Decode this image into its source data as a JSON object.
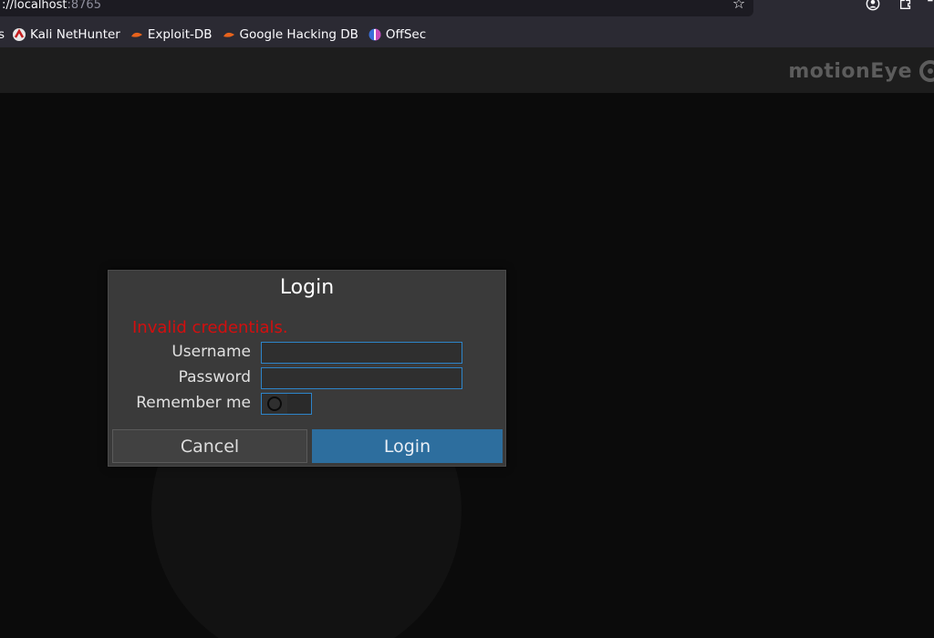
{
  "browser": {
    "url_prefix": "://localhost",
    "url_port": ":8765",
    "bookmarks": {
      "cut_label": "s",
      "items": [
        {
          "label": "Kali NetHunter",
          "icon": "kali-nethunter-icon"
        },
        {
          "label": "Exploit-DB",
          "icon": "exploit-db-icon"
        },
        {
          "label": "Google Hacking DB",
          "icon": "google-hacking-db-icon"
        },
        {
          "label": "OffSec",
          "icon": "offsec-icon"
        }
      ]
    }
  },
  "app": {
    "brand": "motionEye"
  },
  "login_dialog": {
    "title": "Login",
    "error": "Invalid credentials.",
    "username_label": "Username",
    "password_label": "Password",
    "remember_label": "Remember me",
    "username_value": "",
    "password_value": "",
    "remember_checked": false,
    "cancel_label": "Cancel",
    "login_label": "Login"
  },
  "colors": {
    "error": "#d20f0f",
    "accent": "#2d6e9e",
    "field_border": "#2d84c9"
  }
}
